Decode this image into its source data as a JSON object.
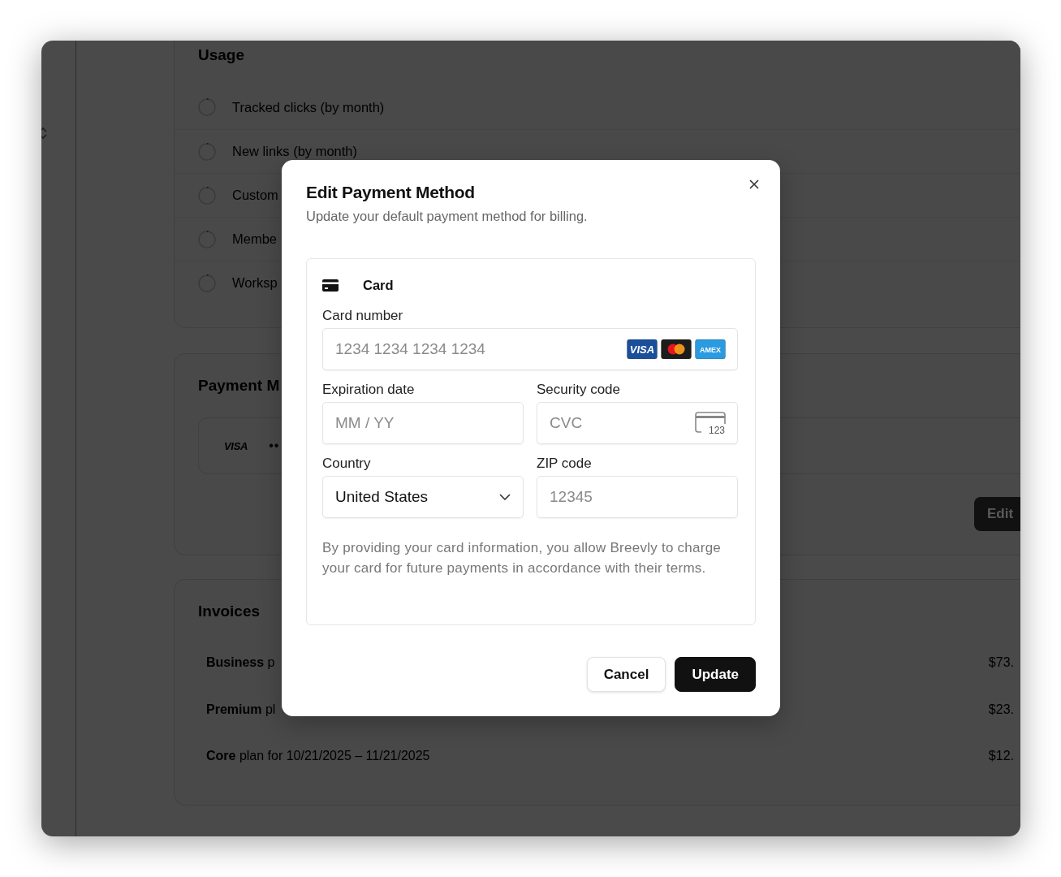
{
  "usage": {
    "title": "Usage",
    "items": [
      {
        "label": "Tracked clicks (by month)"
      },
      {
        "label": "New links (by month)"
      },
      {
        "label": "Custom"
      },
      {
        "label": "Membe"
      },
      {
        "label": "Worksp"
      }
    ]
  },
  "payment_method": {
    "title": "Payment M",
    "brand": "VISA",
    "masked": "••",
    "edit_button": "Edit"
  },
  "invoices": {
    "title": "Invoices",
    "rows": [
      {
        "description": "**Business** p",
        "amount": "$73."
      },
      {
        "description": "**Premium** pl",
        "amount": "$23."
      },
      {
        "description": "**Core** plan for 10/21/2025 – 11/21/2025",
        "amount": "$12."
      }
    ]
  },
  "dialog": {
    "title": "Edit Payment Method",
    "subtitle": "Update your default payment method for billing.",
    "method": "Card",
    "fields": [
      {
        "kind": "card_number",
        "label": "Card number",
        "placeholder": "1234 1234 1234 1234",
        "brands": [
          {
            "kind": "visa",
            "label": "VISA"
          },
          {
            "kind": "mastercard"
          },
          {
            "kind": "amex",
            "label": "AMEX"
          }
        ]
      },
      {
        "kind": "text",
        "label": "Expiration date",
        "placeholder": "MM / YY"
      },
      {
        "kind": "cvc",
        "label": "Security code",
        "placeholder": "CVC",
        "icon_text": "123"
      },
      {
        "kind": "select",
        "label": "Country",
        "value": "United States"
      },
      {
        "kind": "text",
        "label": "ZIP code",
        "placeholder": "12345"
      }
    ],
    "disclaimer": "By providing your card information, you allow Breevly to charge your card for future payments in accordance with their terms.",
    "buttons": [
      {
        "kind": "secondary",
        "label": "Cancel"
      },
      {
        "kind": "primary",
        "label": "Update"
      }
    ]
  }
}
